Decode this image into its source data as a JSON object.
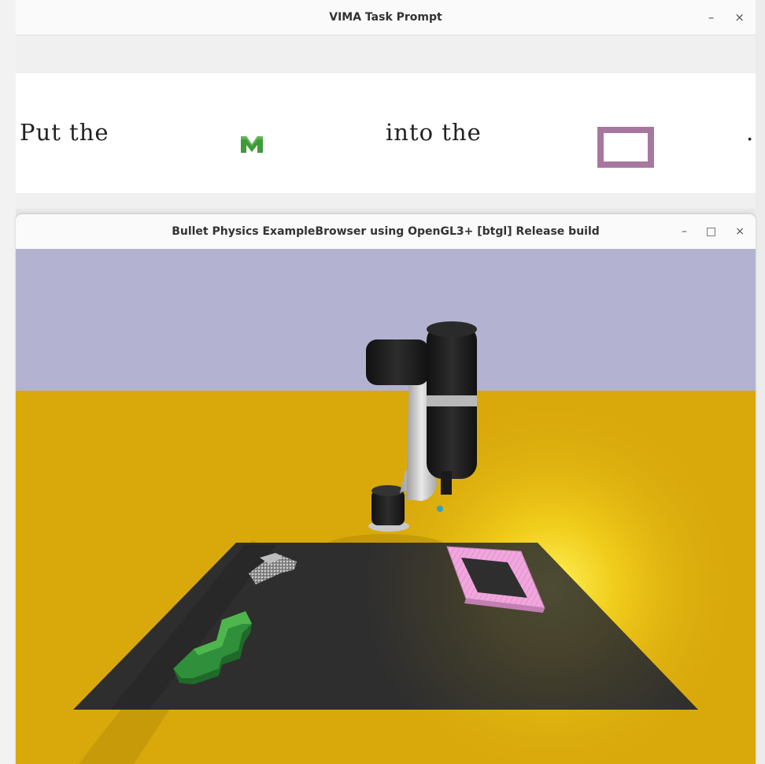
{
  "vima_window": {
    "title": "VIMA Task Prompt",
    "minimize_label": "–",
    "close_label": "×",
    "prompt": {
      "part1": "Put the",
      "object_icon_letter": "M",
      "part2": "into the",
      "end": "."
    },
    "colors": {
      "object_green": "#3f9a3a",
      "frame_purple": "#a7789f"
    }
  },
  "bullet_window": {
    "title": "Bullet Physics ExampleBrowser using OpenGL3+ [btgl] Release build",
    "minimize_label": "–",
    "maximize_label": "□",
    "close_label": "×",
    "scene": {
      "sky_color": "#b3b3d1",
      "floor_color": "#d9a90c",
      "table_color": "#2e2e2e",
      "object_green": "#2f8f3a",
      "frame_pink": "#f2a6de"
    }
  }
}
